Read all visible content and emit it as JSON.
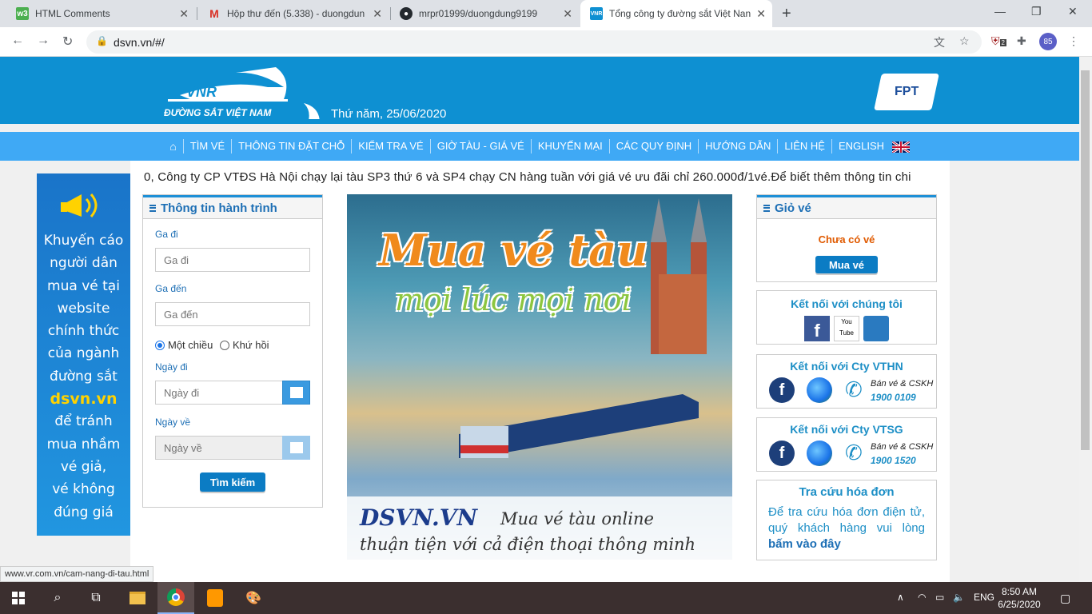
{
  "browser": {
    "tabs": [
      {
        "title": "HTML Comments",
        "icon": "w3schools-icon"
      },
      {
        "title": "Hộp thư đến (5.338) - duongdun",
        "icon": "gmail-icon"
      },
      {
        "title": "mrpr01999/duongdung9199",
        "icon": "github-icon"
      },
      {
        "title": "Tổng công ty đường sắt Việt Nan",
        "icon": "vnr-icon"
      }
    ],
    "url": "dsvn.vn/#/",
    "profile_badge": "85",
    "ext_badge": "2",
    "status_url": "www.vr.com.vn/cam-nang-di-tau.html"
  },
  "header": {
    "logo_text": "ĐƯỜNG SẮT VIỆT NAM",
    "date": "Thứ năm, 25/06/2020",
    "partner_logo": "FPT"
  },
  "menu": {
    "items": [
      "TÌM VÉ",
      "THÔNG TIN ĐẶT CHỖ",
      "KIỂM TRA VÉ",
      "GIỜ TÀU - GIÁ VÉ",
      "KHUYẾN MẠI",
      "CÁC QUY ĐỊNH",
      "HƯỚNG DẪN",
      "LIÊN HỆ",
      "ENGLISH"
    ]
  },
  "ticker": "0, Công ty CP VTĐS Hà Nội chạy lại tàu SP3 thứ 6 và SP4 chạy CN hàng tuần với giá vé ưu đãi chỉ 260.000đ/1vé.Để biết thêm thông tin chi",
  "ad": {
    "lines": [
      "Khuyến cáo",
      "người dân",
      "mua vé tại",
      "website",
      "chính thức",
      "của ngành",
      "đường sắt"
    ],
    "highlight": "dsvn.vn",
    "lines2": [
      "để tránh",
      "mua nhầm",
      "vé giả,",
      "vé không",
      "đúng giá"
    ]
  },
  "search": {
    "title": "Thông tin hành trình",
    "from_label": "Ga đi",
    "from_placeholder": "Ga đi",
    "to_label": "Ga đến",
    "to_placeholder": "Ga đến",
    "oneway": "Một chiều",
    "roundtrip": "Khứ hồi",
    "depart_label": "Ngày đi",
    "depart_placeholder": "Ngày đi",
    "return_label": "Ngày về",
    "return_placeholder": "Ngày về",
    "submit": "Tìm kiếm"
  },
  "banner": {
    "title1": "Mua vé tàu",
    "title2": "mọi lúc mọi nơi",
    "site": "DSVN.VN",
    "sub1": "Mua vé tàu online",
    "sub2": "thuận tiện với cả điện thoại thông minh"
  },
  "cart": {
    "title": "Giỏ vé",
    "empty": "Chưa có vé",
    "buy": "Mua vé"
  },
  "connect": {
    "title": "Kết nối với chúng tôi",
    "youtube": "You Tube"
  },
  "vthn": {
    "title": "Kết nối với Cty VTHN",
    "label": "Bán vé & CSKH",
    "phone": "1900 0109"
  },
  "vtsg": {
    "title": "Kết nối với Cty VTSG",
    "label": "Bán vé & CSKH",
    "phone": "1900 1520"
  },
  "invoice": {
    "title": "Tra cứu hóa đơn",
    "text": "Để tra cứu hóa đơn điện tử, quý khách hàng vui lòng ",
    "link": "bấm vào đây"
  },
  "taskbar": {
    "lang": "ENG",
    "time": "8:50 AM",
    "date": "6/25/2020"
  },
  "colors": {
    "header_blue": "#0e90d2",
    "menu_blue": "#3fa9f5",
    "title_blue": "#1d6fb5",
    "accent_orange": "#e05a00"
  }
}
